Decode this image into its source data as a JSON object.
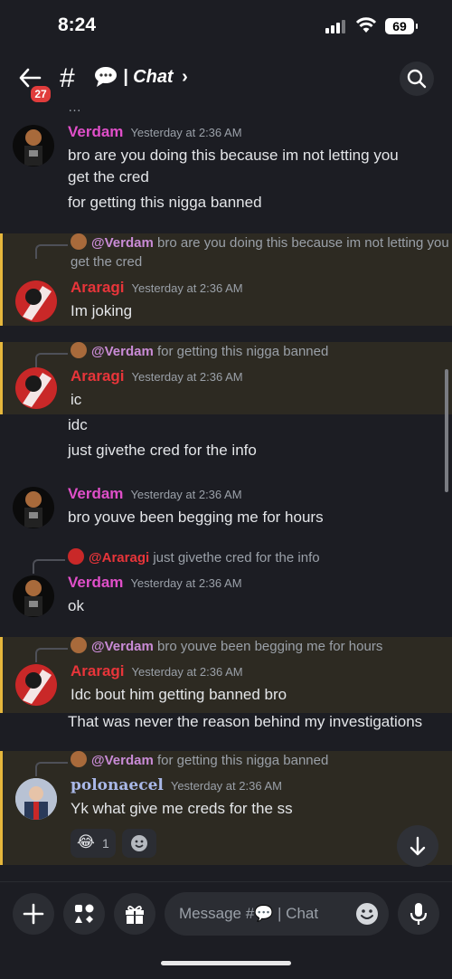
{
  "status_bar": {
    "time": "8:24",
    "battery": "69"
  },
  "header": {
    "back_badge": "27",
    "channel_hash": "#",
    "channel_emoji": "💬",
    "channel_name": "| Chat",
    "chevron": "›"
  },
  "messages": [
    {
      "author": "Verdam",
      "time": "Yesterday at 2:36 AM",
      "lines": [
        "bro are you doing this because im not letting you",
        "get the cred",
        "for getting this nigga banned"
      ]
    },
    {
      "reply_to": "@Verdam",
      "reply_text": "bro are you doing this because im not letting you get the cred",
      "author": "Araragi",
      "time": "Yesterday at 2:36 AM",
      "lines": [
        "Im joking"
      ]
    },
    {
      "reply_to": "@Verdam",
      "reply_text": "for getting this nigga banned",
      "author": "Araragi",
      "time": "Yesterday at 2:36 AM",
      "lines": [
        "ic",
        "idc",
        "just givethe cred for the info"
      ]
    },
    {
      "author": "Verdam",
      "time": "Yesterday at 2:36 AM",
      "lines": [
        "bro youve been begging me for hours"
      ]
    },
    {
      "reply_to": "@Araragi",
      "reply_text": "just givethe cred for the info",
      "author": "Verdam",
      "time": "Yesterday at 2:36 AM",
      "lines": [
        "ok"
      ]
    },
    {
      "reply_to": "@Verdam",
      "reply_text": "bro youve been begging me for hours",
      "author": "Araragi",
      "time": "Yesterday at 2:36 AM",
      "lines": [
        "Idc bout him getting banned bro",
        "That was never the reason behind my investigations"
      ]
    },
    {
      "reply_to": "@Verdam",
      "reply_text": "for getting this nigga banned",
      "author": "polonaecel",
      "time": "Yesterday at 2:36 AM",
      "lines": [
        "Yk what give me creds for the ss"
      ],
      "reaction": {
        "emoji": "😂",
        "count": "1"
      }
    }
  ],
  "composer": {
    "placeholder": "Message #💬 | Chat"
  },
  "colors": {
    "verdam": "#e04fc9",
    "araragi": "#e8353a",
    "polonaecel": "#a9b8e8",
    "highlight_bar": "#e6b73c"
  }
}
